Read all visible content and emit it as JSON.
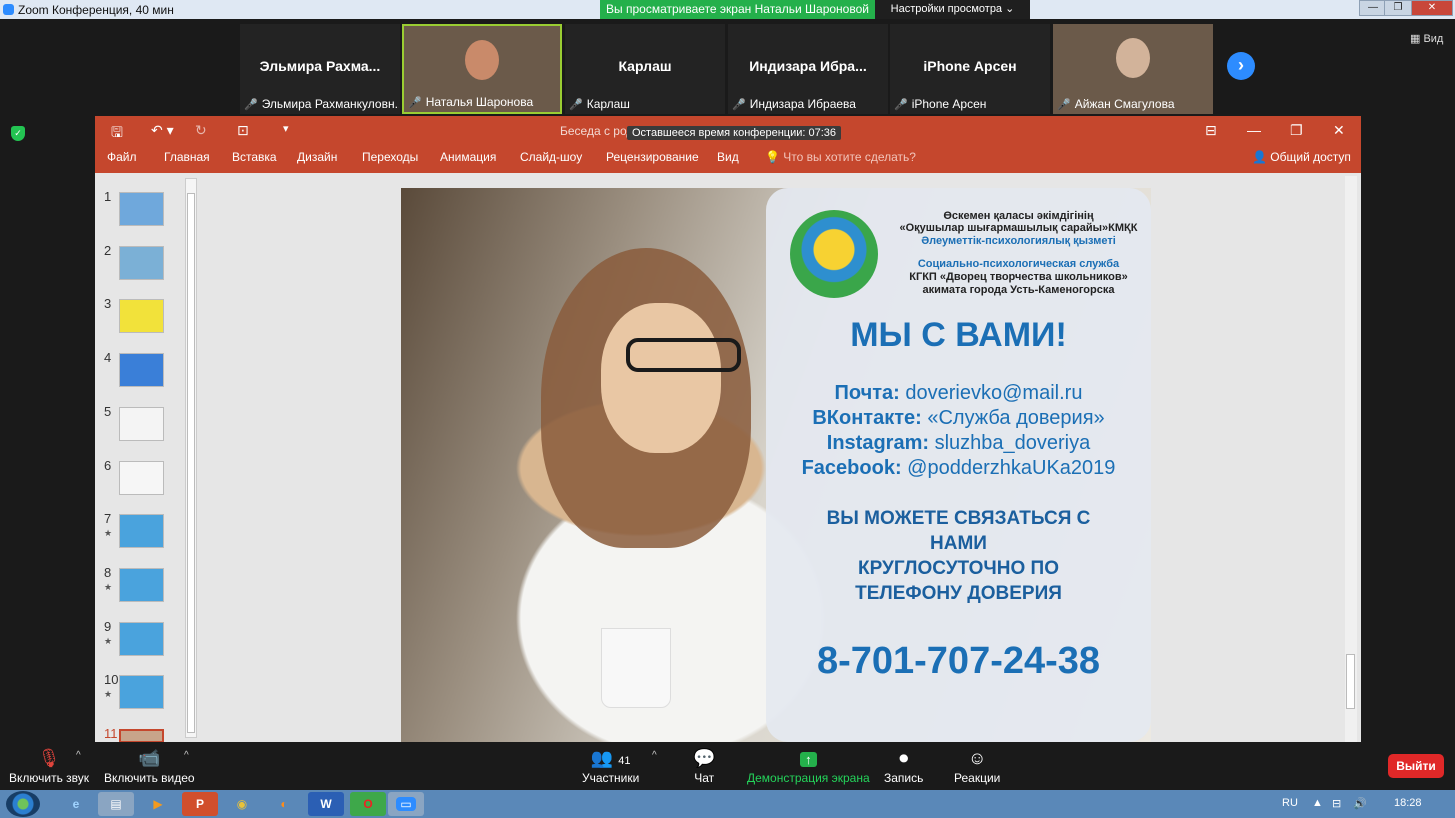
{
  "window": {
    "title": "Zoom Конференция, 40 мин",
    "sharing_banner": "Вы просматриваете экран Натальи Шароновой",
    "view_settings": "Настройки просмотра"
  },
  "participants": [
    {
      "display": "Эльмира  Рахма...",
      "name": "Эльмира Рахманкуловн...",
      "video": false
    },
    {
      "display": "",
      "name": "Наталья Шаронова",
      "video": true,
      "active": true
    },
    {
      "display": "Карлаш",
      "name": "Карлаш",
      "video": false
    },
    {
      "display": "Индизара  Ибра...",
      "name": "Индизара Ибраева",
      "video": false
    },
    {
      "display": "iPhone Арсен",
      "name": "iPhone Арсен",
      "video": false
    },
    {
      "display": "",
      "name": "Айжан Смагулова",
      "video": true
    }
  ],
  "view_label": "Вид",
  "ppt": {
    "title": "Беседа с роди...",
    "timer": "Оставшееся время конференции: 07:36",
    "menu": [
      "Файл",
      "Главная",
      "Вставка",
      "Дизайн",
      "Переходы",
      "Анимация",
      "Слайд-шоу",
      "Рецензирование",
      "Вид"
    ],
    "tell_me": "Что вы хотите сделать?",
    "share": "Общий доступ",
    "thumbnails": [
      "1",
      "2",
      "3",
      "4",
      "5",
      "6",
      "7",
      "8",
      "9",
      "10",
      "11"
    ]
  },
  "slide": {
    "org_kz_1": "Өскемен қаласы әкімдігінің",
    "org_kz_2": "«Оқушылар шығармашылық сарайы»КМҚК",
    "org_kz_3": "Әлеуметтік-психологиялық қызметі",
    "org_ru_1": "Социально-психологическая служба",
    "org_ru_2": "КГКП «Дворец творчества школьников»",
    "org_ru_3": "акимата города Усть-Каменогорска",
    "headline": "МЫ С ВАМИ!",
    "contacts": [
      {
        "key": "Почта:",
        "value": "doverievko@mail.ru"
      },
      {
        "key": "ВКонтакте:",
        "value": "«Служба доверия»"
      },
      {
        "key": "Instagram:",
        "value": "sluzhba_doveriya"
      },
      {
        "key": "Facebook:",
        "value": "@podderzhkaUKa2019"
      }
    ],
    "cta_1": "ВЫ МОЖЕТЕ СВЯЗАТЬСЯ С",
    "cta_2": "НАМИ",
    "cta_3": "КРУГЛОСУТОЧНО ПО",
    "cta_4": "ТЕЛЕФОНУ ДОВЕРИЯ",
    "phone": "8-701-707-24-38"
  },
  "toolbar": {
    "audio": "Включить звук",
    "video": "Включить видео",
    "participants": "Участники",
    "participants_count": "41",
    "chat": "Чат",
    "share": "Демонстрация экрана",
    "record": "Запись",
    "reactions": "Реакции",
    "leave": "Выйти"
  },
  "taskbar": {
    "lang": "RU",
    "time": "18:28"
  },
  "colors": {
    "ppt_accent": "#c5472d",
    "share_green": "#24b04b",
    "zoom_blue": "#2d8cff",
    "slide_blue": "#1b6fb5"
  }
}
